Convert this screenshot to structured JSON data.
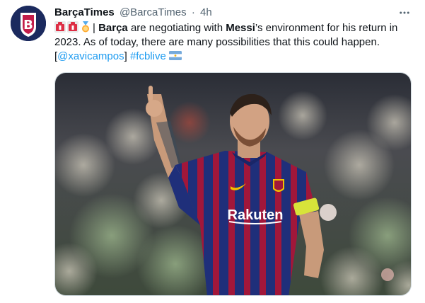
{
  "tweet": {
    "display_name": "BarçaTimes",
    "handle": "@BarcaTimes",
    "separator": "·",
    "time": "4h",
    "text": {
      "seg1": "| ",
      "seg2": "Barça",
      "seg3": " are negotiating with ",
      "seg4": "Messi",
      "seg5": "’s environment for his return in 2023. As of today, there are many possibilities that this could happen. [",
      "mention": "@xavicampos",
      "seg6": "] ",
      "hashtag": "#fcblive"
    },
    "emojis": [
      "alarm-emoji",
      "alarm-emoji",
      "medal-emoji"
    ],
    "flag": "argentina-flag",
    "media": {
      "shirt_sponsor": "Rakuten",
      "description_icon": "photo"
    }
  },
  "colors": {
    "link": "#1d9bf0",
    "secondary_text": "#536471",
    "primary_text": "#0f1419",
    "shirt_blue": "#1f2f7a",
    "shirt_red": "#a1173a",
    "captain_band": "#d7e33a"
  }
}
